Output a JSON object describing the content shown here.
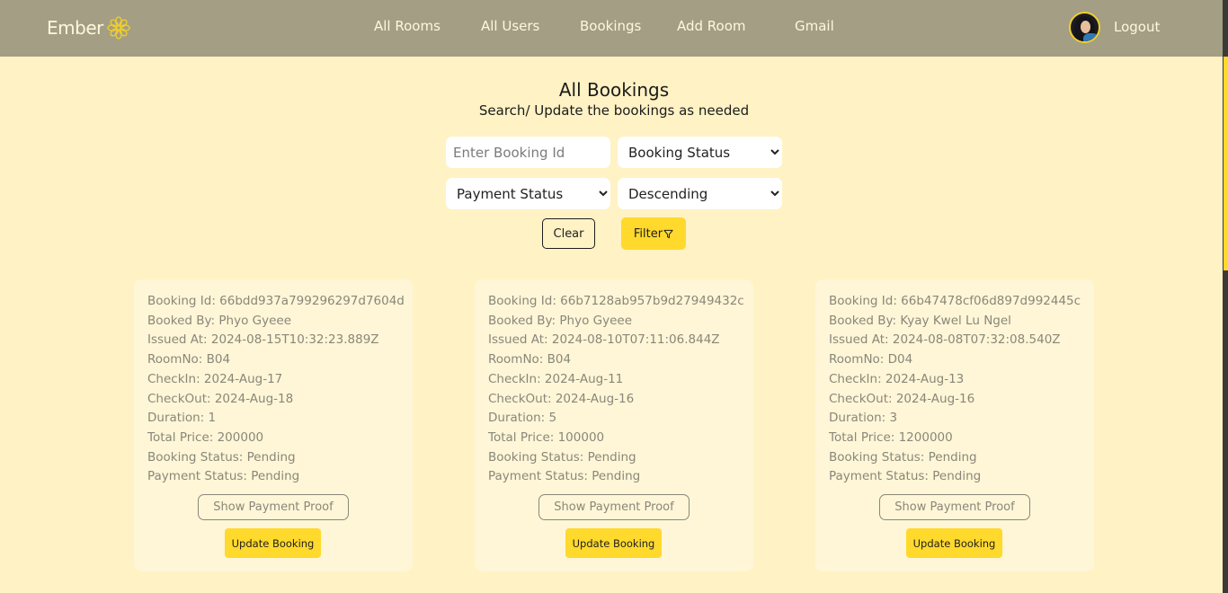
{
  "brand": {
    "name": "Ember",
    "logo_icon": "mandala-flower-icon",
    "accent": "#f1cf2a"
  },
  "nav": {
    "links": [
      "All Rooms",
      "All Users",
      "Bookings",
      "Add Room",
      "Gmail"
    ],
    "logout_label": "Logout",
    "background": "#a39e84"
  },
  "page": {
    "title": "All Bookings",
    "subtitle": "Search/ Update the bookings as needed",
    "background": "#fff2c4"
  },
  "filters": {
    "booking_id_placeholder": "Enter Booking Id",
    "booking_id_value": "",
    "booking_status_selected": "Booking Status",
    "payment_status_selected": "Payment Status",
    "sort_order_selected": "Descending",
    "clear_label": "Clear",
    "filter_label": "Filter",
    "filter_icon": "funnel-icon"
  },
  "labels": {
    "booking_id": "Booking Id: ",
    "booked_by": "Booked By: ",
    "issued_at": "Issued At: ",
    "room_no": "RoomNo: ",
    "check_in": "CheckIn: ",
    "check_out": "CheckOut: ",
    "duration": "Duration: ",
    "total_price": "Total Price: ",
    "booking_status": "Booking Status: ",
    "payment_status": "Payment Status: ",
    "show_payment_proof": "Show Payment Proof",
    "update_booking": "Update Booking"
  },
  "bookings": [
    {
      "booking_id": "66bdd937a799296297d7604d",
      "booked_by": "Phyo Gyeee",
      "issued_at": "2024-08-15T10:32:23.889Z",
      "room_no": "B04",
      "check_in": "2024-Aug-17",
      "check_out": "2024-Aug-18",
      "duration": "1",
      "total_price": "200000",
      "booking_status": "Pending",
      "payment_status": "Pending"
    },
    {
      "booking_id": "66b7128ab957b9d27949432c",
      "booked_by": "Phyo Gyeee",
      "issued_at": "2024-08-10T07:11:06.844Z",
      "room_no": "B04",
      "check_in": "2024-Aug-11",
      "check_out": "2024-Aug-16",
      "duration": "5",
      "total_price": "100000",
      "booking_status": "Pending",
      "payment_status": "Pending"
    },
    {
      "booking_id": "66b47478cf06d897d992445c",
      "booked_by": "Kyay Kwel Lu Ngel",
      "issued_at": "2024-08-08T07:32:08.540Z",
      "room_no": "D04",
      "check_in": "2024-Aug-13",
      "check_out": "2024-Aug-16",
      "duration": "3",
      "total_price": "1200000",
      "booking_status": "Pending",
      "payment_status": "Pending"
    }
  ]
}
